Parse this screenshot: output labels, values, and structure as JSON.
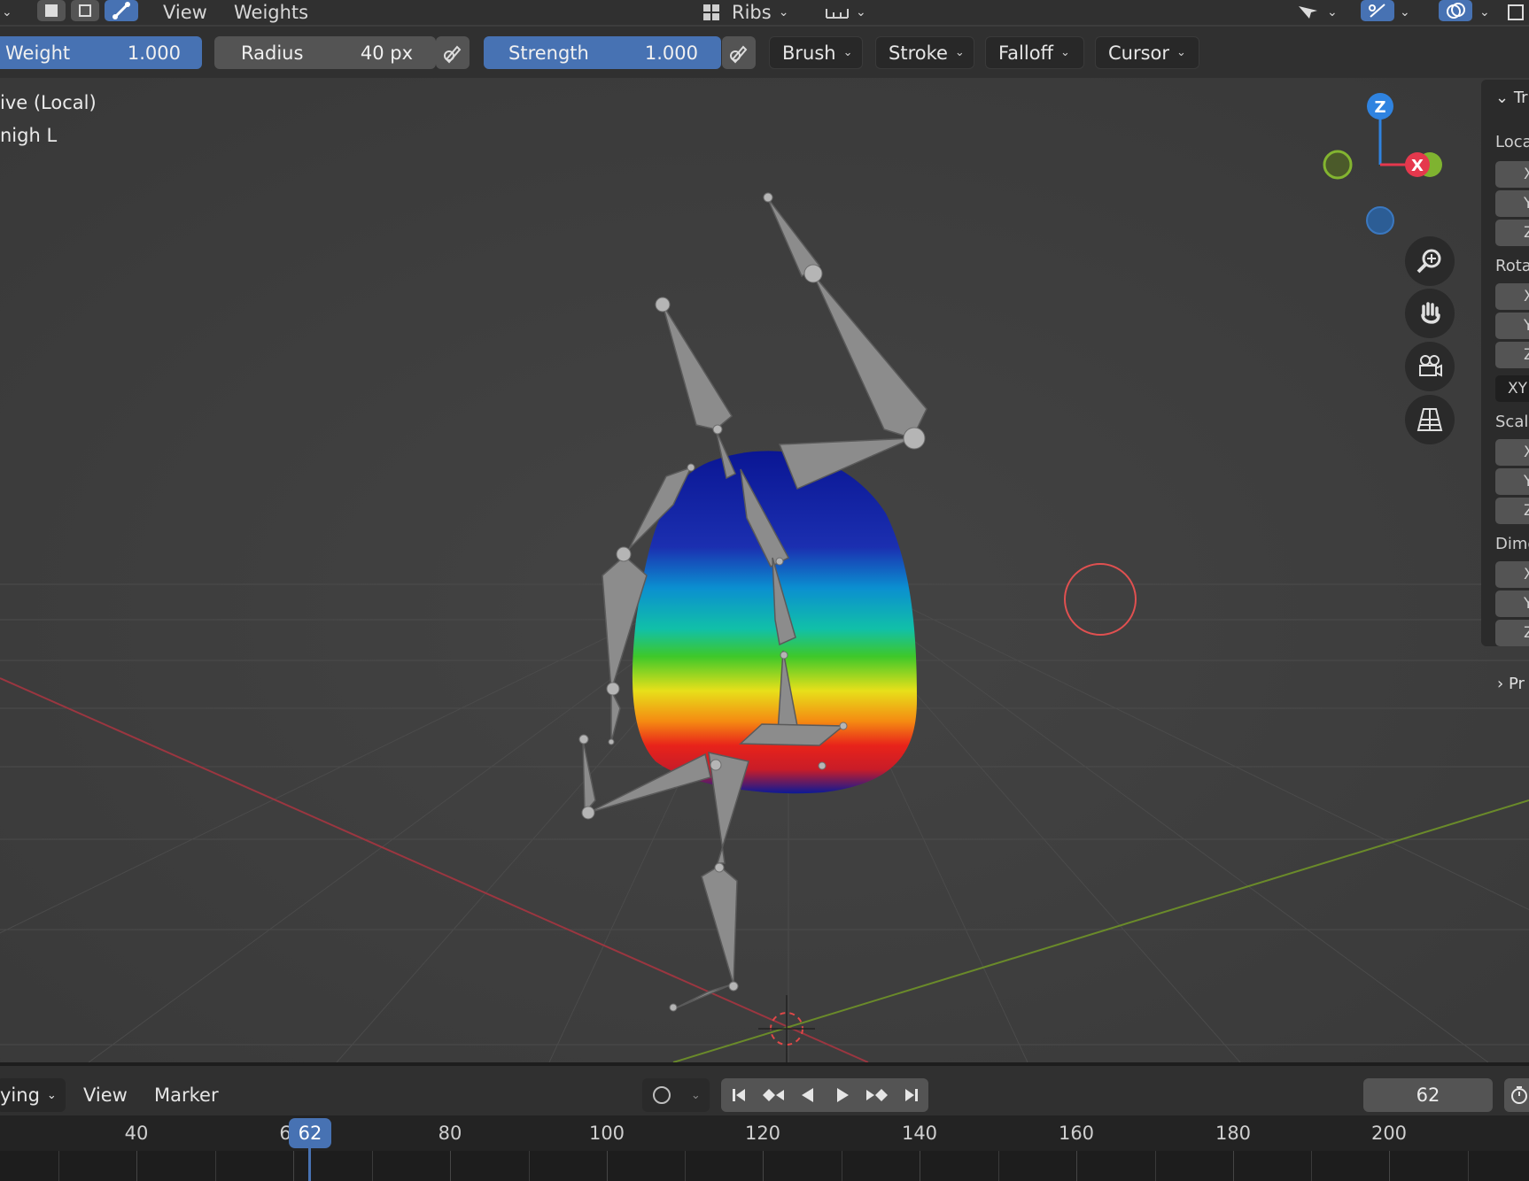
{
  "topbar": {
    "menu_view": "View",
    "menu_weights": "Weights",
    "bone_collection": "Ribs"
  },
  "tool_header": {
    "weight": {
      "label": "Weight",
      "value": "1.000"
    },
    "radius": {
      "label": "Radius",
      "value": "40 px"
    },
    "strength": {
      "label": "Strength",
      "value": "1.000"
    },
    "menus": [
      "Brush",
      "Stroke",
      "Falloff",
      "Cursor"
    ]
  },
  "viewport": {
    "overlay_line1": "ive (Local)",
    "overlay_line2": "nigh L",
    "gizmo_z": "Z",
    "gizmo_x": "X",
    "nav_buttons": [
      "zoom-icon",
      "pan-hand-icon",
      "camera-icon",
      "perspective-grid-icon"
    ]
  },
  "npanel": {
    "header_partial": "Tr",
    "location_partial": "Loca",
    "rotation_partial": "Rota",
    "mode_partial": "XY",
    "scale_partial": "Scal",
    "dimensions_partial": "Dime",
    "properties_partial": "Pr",
    "axes": [
      "X",
      "Y",
      "Z"
    ]
  },
  "timeline": {
    "mode_partial": "ying",
    "menu_view": "View",
    "menu_marker": "Marker",
    "current_frame": "62",
    "ruler_hidden_digit": "6",
    "ruler_labels": [
      "40",
      "80",
      "100",
      "120",
      "140",
      "160",
      "180",
      "200"
    ]
  },
  "colors": {
    "accent_blue": "#4772b3",
    "axis_x_red": "#e5384d",
    "axis_y_green": "#83b530",
    "axis_z_blue": "#2f83e0"
  }
}
